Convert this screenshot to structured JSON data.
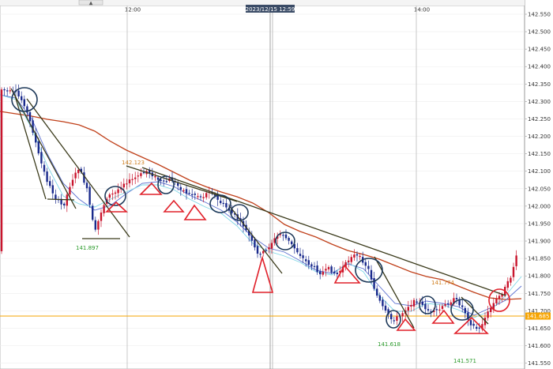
{
  "toolbar": {
    "scroll_glyph": "▲"
  },
  "header": {
    "cursor_time": "2023/12/15 12:59"
  },
  "time_labels": [
    "12:00",
    "14:00"
  ],
  "current_price": {
    "label": "141.685",
    "value": 141.685,
    "color": "#f6a400"
  },
  "colors": {
    "up_candle": "#c9152d",
    "down_candle": "#1a2a8c",
    "ma_long": "#c0401a",
    "ma_mid": "#5a6fd0",
    "ma_short": "#7fd6e6",
    "trend_line": "#3a3a1a",
    "circle": "#1f3a5a",
    "triangle": "#e0202a",
    "high_label": "#d08020",
    "low_label": "#2a9a2a"
  },
  "chart_data": {
    "type": "candlestick",
    "ylim": [
      141.55,
      142.57
    ],
    "y_ticks": [
      "142.550",
      "142.500",
      "142.450",
      "142.400",
      "142.350",
      "142.300",
      "142.250",
      "142.200",
      "142.150",
      "142.100",
      "142.050",
      "142.000",
      "141.950",
      "141.900",
      "141.850",
      "141.800",
      "141.750",
      "141.700",
      "141.650",
      "141.600",
      "141.550"
    ],
    "annotations": [
      {
        "text": "142.123",
        "kind": "high"
      },
      {
        "text": "141.897",
        "kind": "low"
      },
      {
        "text": "141.618",
        "kind": "low"
      },
      {
        "text": "141.774",
        "kind": "high"
      },
      {
        "text": "141.571",
        "kind": "low"
      }
    ]
  }
}
